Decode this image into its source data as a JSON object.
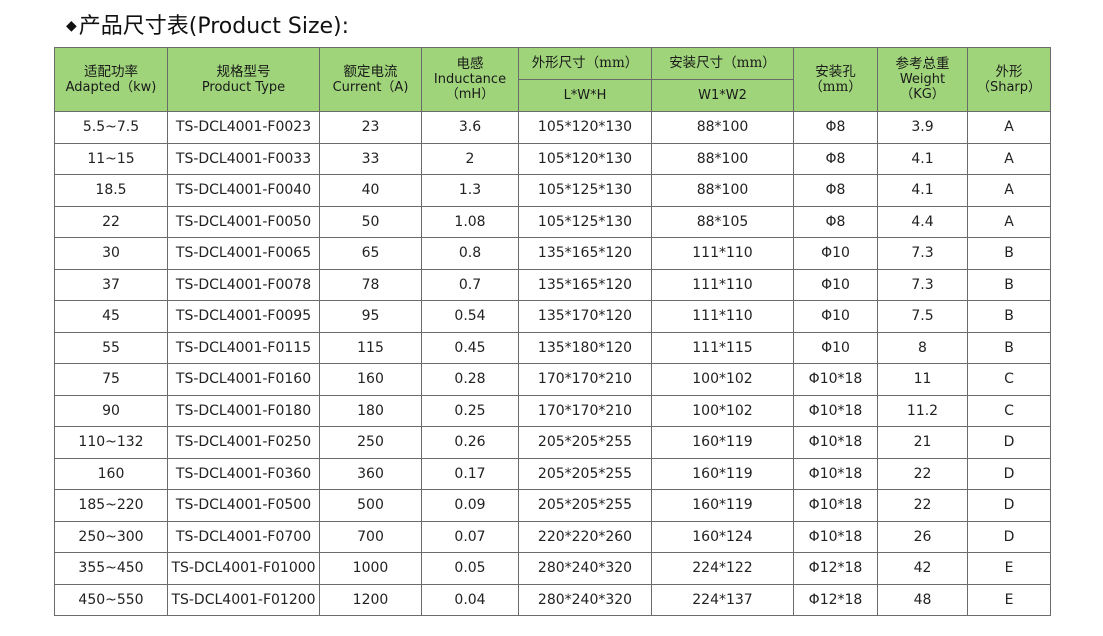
{
  "title": "产品尺寸表(Product Size):",
  "header": {
    "power_cn": "适配功率",
    "power_en": "Adapted（kw)",
    "type_cn": "规格型号",
    "type_en": "Product Type",
    "current_cn": "额定电流",
    "current_en": "Current（A)",
    "inductance_cn": "电感",
    "inductance_en": "Inductance",
    "inductance_unit": "（mH）",
    "outer_cn": "外形尺寸（mm）",
    "outer_sub": "L*W*H",
    "install_cn": "安装尺寸（mm）",
    "install_sub": "W1*W2",
    "hole_cn": "安装孔",
    "hole_unit": "（mm）",
    "weight_cn": "参考总重",
    "weight_en": "Weight",
    "weight_unit": "（KG）",
    "shape_cn": "外形",
    "shape_en": "（Sharp）"
  },
  "rows": [
    [
      "5.5~7.5",
      "TS-DCL4001-F0023",
      "23",
      "3.6",
      "105*120*130",
      "88*100",
      "Φ8",
      "3.9",
      "A"
    ],
    [
      "11~15",
      "TS-DCL4001-F0033",
      "33",
      "2",
      "105*120*130",
      "88*100",
      "Φ8",
      "4.1",
      "A"
    ],
    [
      "18.5",
      "TS-DCL4001-F0040",
      "40",
      "1.3",
      "105*125*130",
      "88*100",
      "Φ8",
      "4.1",
      "A"
    ],
    [
      "22",
      "TS-DCL4001-F0050",
      "50",
      "1.08",
      "105*125*130",
      "88*105",
      "Φ8",
      "4.4",
      "A"
    ],
    [
      "30",
      "TS-DCL4001-F0065",
      "65",
      "0.8",
      "135*165*120",
      "111*110",
      "Φ10",
      "7.3",
      "B"
    ],
    [
      "37",
      "TS-DCL4001-F0078",
      "78",
      "0.7",
      "135*165*120",
      "111*110",
      "Φ10",
      "7.3",
      "B"
    ],
    [
      "45",
      "TS-DCL4001-F0095",
      "95",
      "0.54",
      "135*170*120",
      "111*110",
      "Φ10",
      "7.5",
      "B"
    ],
    [
      "55",
      "TS-DCL4001-F0115",
      "115",
      "0.45",
      "135*180*120",
      "111*115",
      "Φ10",
      "8",
      "B"
    ],
    [
      "75",
      "TS-DCL4001-F0160",
      "160",
      "0.28",
      "170*170*210",
      "100*102",
      "Φ10*18",
      "11",
      "C"
    ],
    [
      "90",
      "TS-DCL4001-F0180",
      "180",
      "0.25",
      "170*170*210",
      "100*102",
      "Φ10*18",
      "11.2",
      "C"
    ],
    [
      "110~132",
      "TS-DCL4001-F0250",
      "250",
      "0.26",
      "205*205*255",
      "160*119",
      "Φ10*18",
      "21",
      "D"
    ],
    [
      "160",
      "TS-DCL4001-F0360",
      "360",
      "0.17",
      "205*205*255",
      "160*119",
      "Φ10*18",
      "22",
      "D"
    ],
    [
      "185~220",
      "TS-DCL4001-F0500",
      "500",
      "0.09",
      "205*205*255",
      "160*119",
      "Φ10*18",
      "22",
      "D"
    ],
    [
      "250~300",
      "TS-DCL4001-F0700",
      "700",
      "0.07",
      "220*220*260",
      "160*124",
      "Φ10*18",
      "26",
      "D"
    ],
    [
      "355~450",
      "TS-DCL4001-F01000",
      "1000",
      "0.05",
      "280*240*320",
      "224*122",
      "Φ12*18",
      "42",
      "E"
    ],
    [
      "450~550",
      "TS-DCL4001-F01200",
      "1200",
      "0.04",
      "280*240*320",
      "224*137",
      "Φ12*18",
      "48",
      "E"
    ]
  ]
}
